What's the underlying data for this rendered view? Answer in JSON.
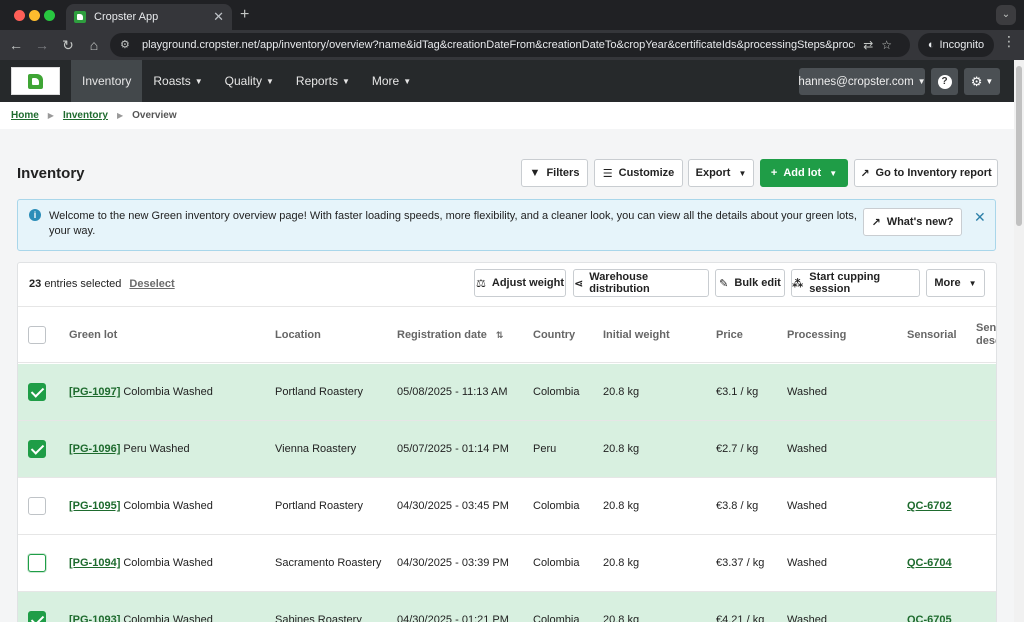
{
  "browser": {
    "tab_title": "Cropster App",
    "url": "playground.cropster.net/app/inventory/overview?name&idTag&creationDateFrom&creationDateTo&cropYear&certificateIds&processingSteps&processin…",
    "incognito_label": "Incognito"
  },
  "nav": {
    "items": [
      {
        "label": "Inventory",
        "caret": false
      },
      {
        "label": "Roasts",
        "caret": true
      },
      {
        "label": "Quality",
        "caret": true
      },
      {
        "label": "Reports",
        "caret": true
      },
      {
        "label": "More",
        "caret": true
      }
    ],
    "user": "hannes@cropster.com",
    "help": "?"
  },
  "breadcrumb": {
    "home": "Home",
    "inventory": "Inventory",
    "current": "Overview"
  },
  "page": {
    "title": "Inventory",
    "actions": {
      "filters": "Filters",
      "customize": "Customize",
      "export": "Export",
      "add_lot": "Add lot",
      "report": "Go to Inventory report"
    }
  },
  "alert": {
    "message": "Welcome to the new Green inventory overview page! With faster loading speeds, more flexibility, and a cleaner look, you can view all the details about your green lots, your way.",
    "whats_new": "What's new?"
  },
  "selection": {
    "count": "23",
    "suffix": "entries selected",
    "deselect": "Deselect",
    "actions": {
      "adjust_weight": "Adjust weight",
      "warehouse": "Warehouse distribution",
      "bulk_edit": "Bulk edit",
      "cupping": "Start cupping session",
      "more": "More"
    }
  },
  "table": {
    "columns": {
      "green_lot": "Green lot",
      "location": "Location",
      "registration_date": "Registration date",
      "country": "Country",
      "initial_weight": "Initial weight",
      "price": "Price",
      "processing": "Processing",
      "sensorial": "Sensorial",
      "sensorial_desc": "Sens desc"
    },
    "rows": [
      {
        "id": "[PG-1097]",
        "name": "Colombia Washed",
        "location": "Portland Roastery",
        "date": "05/08/2025 - 11:13 AM",
        "country": "Colombia",
        "weight": "20.8 kg",
        "price": "€3.1 / kg",
        "processing": "Washed",
        "sensorial": "",
        "checked": true,
        "focus": false
      },
      {
        "id": "[PG-1096]",
        "name": "Peru Washed",
        "location": "Vienna Roastery",
        "date": "05/07/2025 - 01:14 PM",
        "country": "Peru",
        "weight": "20.8 kg",
        "price": "€2.7 / kg",
        "processing": "Washed",
        "sensorial": "",
        "checked": true,
        "focus": false
      },
      {
        "id": "[PG-1095]",
        "name": "Colombia Washed",
        "location": "Portland Roastery",
        "date": "04/30/2025 - 03:45 PM",
        "country": "Colombia",
        "weight": "20.8 kg",
        "price": "€3.8 / kg",
        "processing": "Washed",
        "sensorial": "QC-6702",
        "checked": false,
        "focus": false
      },
      {
        "id": "[PG-1094]",
        "name": "Colombia Washed",
        "location": "Sacramento Roastery",
        "date": "04/30/2025 - 03:39 PM",
        "country": "Colombia",
        "weight": "20.8 kg",
        "price": "€3.37 / kg",
        "processing": "Washed",
        "sensorial": "QC-6704",
        "checked": false,
        "focus": true
      },
      {
        "id": "[PG-1093]",
        "name": "Colombia Washed",
        "location": "Sabines Roastery",
        "date": "04/30/2025 - 01:21 PM",
        "country": "Colombia",
        "weight": "20.8 kg",
        "price": "€4.21 / kg",
        "processing": "Washed",
        "sensorial": "QC-6705",
        "checked": true,
        "focus": false
      }
    ]
  }
}
